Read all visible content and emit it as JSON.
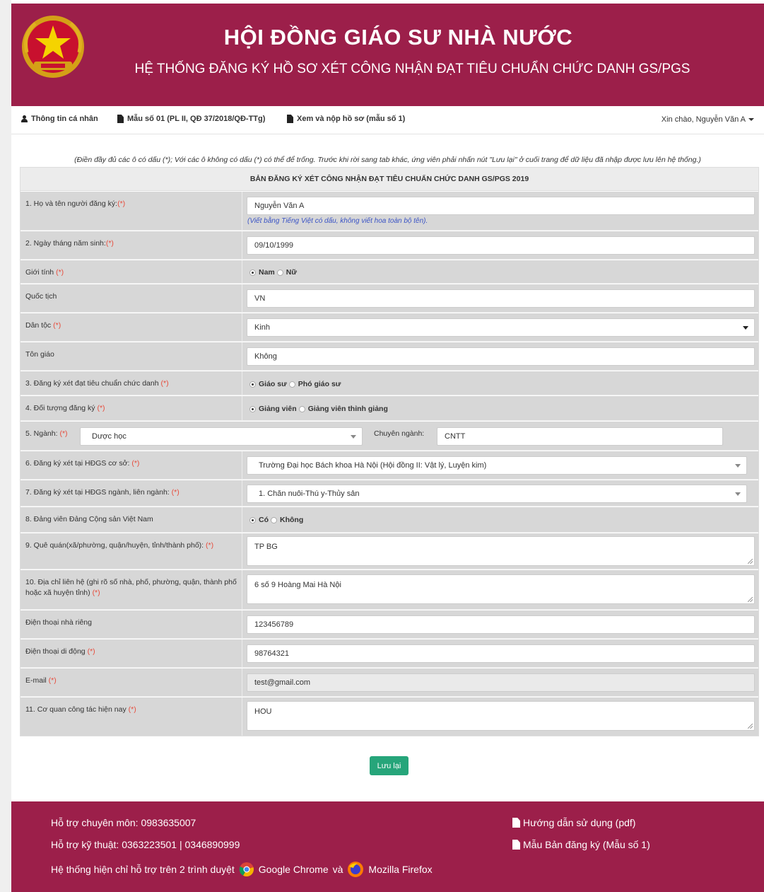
{
  "header": {
    "title": "HỘI ĐỒNG GIÁO SƯ NHÀ NƯỚC",
    "subtitle": "HỆ THỐNG ĐĂNG KÝ HỒ SƠ XÉT CÔNG NHẬN ĐẠT TIÊU CHUẨN CHỨC DANH GS/PGS"
  },
  "nav": {
    "items": [
      "Thông tin cá nhân",
      "Mẫu số 01 (PL II, QĐ 37/2018/QĐ-TTg)",
      "Xem và nộp hồ sơ (mẫu số 1)"
    ],
    "greeting": "Xin chào, Nguyễn Văn A"
  },
  "note": "(Điền đầy đủ các ô có dấu (*); Với các ô không có dấu (*) có thể để trống. Trước khi rời sang tab khác, ứng viên phải nhấn nút \"Lưu lại\" ở cuối trang để dữ liệu đã nhập được lưu lên hệ thống.)",
  "form": {
    "heading": "BẢN ĐĂNG KÝ XÉT CÔNG NHẬN ĐẠT TIÊU CHUẨN CHỨC DANH GS/PGS 2019",
    "req": "(*)",
    "fullname": {
      "label": "1. Họ và tên người đăng ký:",
      "value": "Nguyễn Văn A",
      "hint": "(Viết bằng Tiếng Việt có dấu, không viết hoa toàn bộ tên)."
    },
    "dob": {
      "label": "2. Ngày tháng năm sinh:",
      "value": "09/10/1999"
    },
    "gender": {
      "label": "Giới tính ",
      "opt1": "Nam",
      "opt2": "Nữ"
    },
    "nationality": {
      "label": "Quốc tịch",
      "value": "VN"
    },
    "ethnicity": {
      "label": "Dân tộc ",
      "value": "Kinh"
    },
    "religion": {
      "label": "Tôn giáo",
      "value": "Không"
    },
    "title_reg": {
      "label": "3. Đăng ký xét đạt tiêu chuẩn chức danh ",
      "opt1": "Giáo sư",
      "opt2": "Phó giáo sư"
    },
    "subject": {
      "label": "4. Đối tượng đăng ký ",
      "opt1": "Giảng viên",
      "opt2": "Giảng viên thỉnh giảng"
    },
    "field": {
      "label": "5. Ngành: ",
      "value": "Dược học",
      "spec_label": "Chuyên ngành:",
      "spec_value": "CNTT"
    },
    "base_council": {
      "label": "6. Đăng ký xét tại HĐGS cơ sở: ",
      "value": "Trường Đại học Bách khoa Hà Nội (Hội đồng II: Vật lý, Luyện kim)"
    },
    "field_council": {
      "label": "7. Đăng ký xét tại HĐGS ngành, liên ngành: ",
      "value": "1. Chăn nuôi-Thú y-Thủy sản"
    },
    "party": {
      "label": "8. Đảng viên Đảng Cộng sản Việt Nam",
      "opt1": "Có",
      "opt2": "Không"
    },
    "hometown": {
      "label": "9. Quê quán(xã/phường, quận/huyện, tỉnh/thành phố): ",
      "value": "TP BG"
    },
    "address": {
      "label": "10. Địa chỉ liên hệ (ghi rõ số nhà, phố, phường, quận, thành phố hoặc xã huyện tỉnh) ",
      "value": "6 số 9 Hoàng Mai Hà Nội"
    },
    "home_phone": {
      "label": "Điện thoại nhà riêng",
      "value": "123456789"
    },
    "mobile": {
      "label": "Điện thoại di động ",
      "value": "98764321"
    },
    "email": {
      "label": "E-mail ",
      "value": "test@gmail.com"
    },
    "workplace": {
      "label": "11. Cơ quan công tác hiện nay ",
      "value": "HOU"
    }
  },
  "save_label": "Lưu lại",
  "footer": {
    "support1": "Hỗ trợ chuyên môn: 0983635007",
    "support2": "Hỗ trợ kỹ thuật: 0363223501 | 0346890999",
    "browsers_prefix": "Hệ thống hiện chỉ hỗ trợ trên 2 trình duyệt",
    "chrome": "Google Chrome",
    "and": "và",
    "firefox": "Mozilla Firefox",
    "link1": "Hướng dẫn sử dụng (pdf)",
    "link2": "Mẫu Bản đăng ký (Mẫu số 1)"
  },
  "colors": {
    "brand": "#9c1f4a",
    "save": "#26a57a",
    "hint": "#3a53c5",
    "required": "#e74c3c"
  }
}
